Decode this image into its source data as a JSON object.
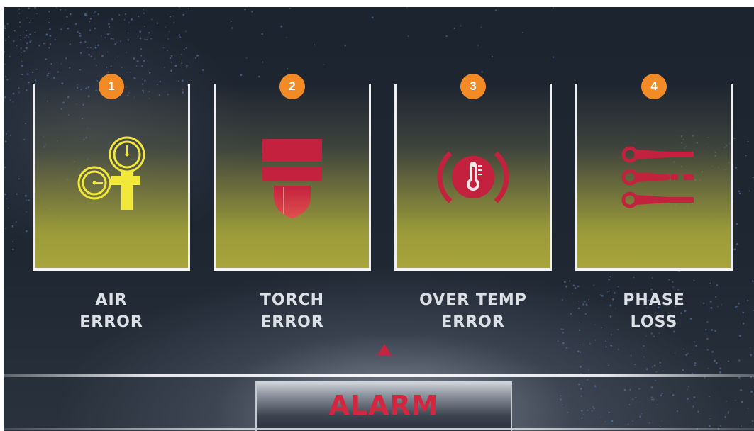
{
  "colors": {
    "badge": "#f28a25",
    "alarm_red": "#d4263e",
    "icon_yellow": "#f2e83a",
    "icon_red": "#c4213e",
    "background": "#1f2733"
  },
  "alerts": [
    {
      "number": "1",
      "icon": "pressure-gauge-icon",
      "line1": "AIR",
      "line2": "ERROR"
    },
    {
      "number": "2",
      "icon": "torch-nozzle-icon",
      "line1": "TORCH",
      "line2": "ERROR"
    },
    {
      "number": "3",
      "icon": "temperature-warning-icon",
      "line1": "OVER TEMP",
      "line2": "ERROR"
    },
    {
      "number": "4",
      "icon": "cable-terminals-icon",
      "line1": "PHASE",
      "line2": "LOSS"
    }
  ],
  "indicator": "triangle-up-icon",
  "alarm_button": {
    "label": "ALARM"
  }
}
